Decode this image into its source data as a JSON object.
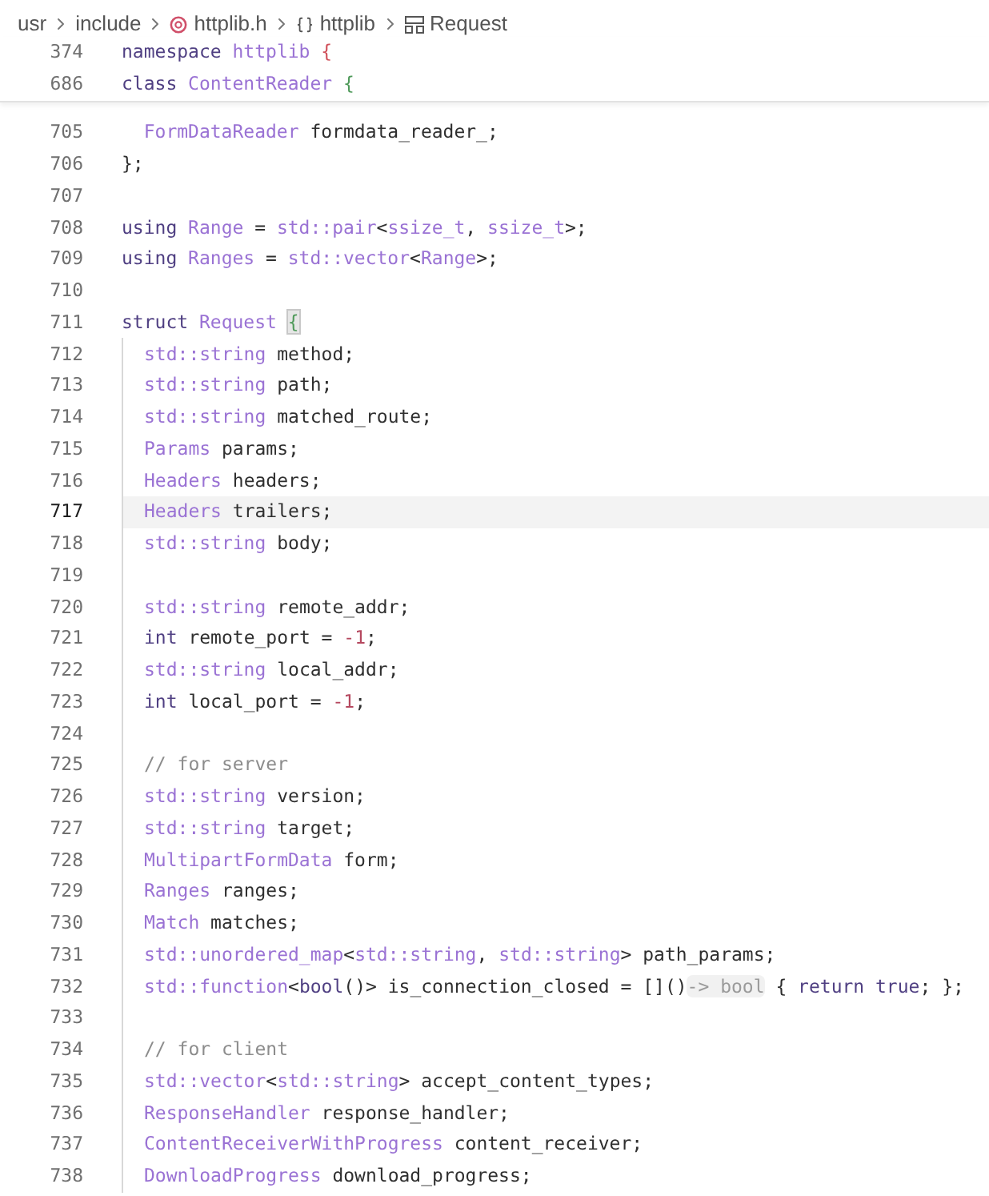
{
  "breadcrumb": [
    {
      "label": "usr",
      "kind": "folder"
    },
    {
      "label": "include",
      "kind": "folder"
    },
    {
      "label": "httplib.h",
      "kind": "file"
    },
    {
      "label": "httplib",
      "kind": "namespace"
    },
    {
      "label": "Request",
      "kind": "struct"
    }
  ],
  "sticky_scroll": [
    {
      "number": "374",
      "tokens": [
        {
          "kind": "kw",
          "text": "namespace "
        },
        {
          "kind": "type",
          "text": "httplib "
        },
        {
          "kind": "brace_red",
          "text": "{"
        }
      ]
    },
    {
      "number": "686",
      "tokens": [
        {
          "kind": "kw",
          "text": "class "
        },
        {
          "kind": "type",
          "text": "ContentReader "
        },
        {
          "kind": "brace_green",
          "text": "{"
        }
      ]
    }
  ],
  "lines": [
    {
      "number": "705",
      "current": false,
      "tokens": [
        {
          "kind": "type",
          "text": "  FormDataReader"
        },
        {
          "kind": "plain",
          "text": " formdata_reader_;"
        }
      ]
    },
    {
      "number": "706",
      "current": false,
      "tokens": [
        {
          "kind": "plain",
          "text": "};"
        }
      ]
    },
    {
      "number": "707",
      "current": false
    },
    {
      "number": "708",
      "current": false,
      "tokens": [
        {
          "kind": "kw",
          "text": "using "
        },
        {
          "kind": "type",
          "text": "Range"
        },
        {
          "kind": "plain",
          "text": " = "
        },
        {
          "kind": "type",
          "text": "std::pair"
        },
        {
          "kind": "plain",
          "text": "<"
        },
        {
          "kind": "type",
          "text": "ssize_t"
        },
        {
          "kind": "plain",
          "text": ", "
        },
        {
          "kind": "type",
          "text": "ssize_t"
        },
        {
          "kind": "plain",
          "text": ">;"
        }
      ]
    },
    {
      "number": "709",
      "current": false,
      "tokens": [
        {
          "kind": "kw",
          "text": "using "
        },
        {
          "kind": "type",
          "text": "Ranges"
        },
        {
          "kind": "plain",
          "text": " = "
        },
        {
          "kind": "type",
          "text": "std::vector"
        },
        {
          "kind": "plain",
          "text": "<"
        },
        {
          "kind": "type",
          "text": "Range"
        },
        {
          "kind": "plain",
          "text": ">;"
        }
      ]
    },
    {
      "number": "710",
      "current": false
    },
    {
      "number": "711",
      "current": false,
      "tokens": [
        {
          "kind": "kw",
          "text": "struct "
        },
        {
          "kind": "type",
          "text": "Request "
        },
        {
          "kind": "brace_match",
          "text": "{"
        }
      ],
      "children": [
        {
          "number": "712",
          "current": false,
          "tokens": [
            {
              "kind": "type",
              "text": "std::string"
            },
            {
              "kind": "plain",
              "text": " method;"
            }
          ]
        },
        {
          "number": "713",
          "current": false,
          "tokens": [
            {
              "kind": "type",
              "text": "std::string"
            },
            {
              "kind": "plain",
              "text": " path;"
            }
          ]
        },
        {
          "number": "714",
          "current": false,
          "tokens": [
            {
              "kind": "type",
              "text": "std::string"
            },
            {
              "kind": "plain",
              "text": " matched_route;"
            }
          ]
        },
        {
          "number": "715",
          "current": false,
          "tokens": [
            {
              "kind": "type",
              "text": "Params"
            },
            {
              "kind": "plain",
              "text": " params;"
            }
          ]
        },
        {
          "number": "716",
          "current": false,
          "tokens": [
            {
              "kind": "type",
              "text": "Headers"
            },
            {
              "kind": "plain",
              "text": " headers;"
            }
          ]
        },
        {
          "number": "717",
          "current": true,
          "tokens": [
            {
              "kind": "type",
              "text": "Headers"
            },
            {
              "kind": "plain",
              "text": " trailers;"
            }
          ]
        },
        {
          "number": "718",
          "current": false,
          "tokens": [
            {
              "kind": "type",
              "text": "std::string"
            },
            {
              "kind": "plain",
              "text": " body;"
            }
          ]
        },
        {
          "number": "719",
          "current": false
        },
        {
          "number": "720",
          "current": false,
          "tokens": [
            {
              "kind": "type",
              "text": "std::string"
            },
            {
              "kind": "plain",
              "text": " remote_addr;"
            }
          ]
        },
        {
          "number": "721",
          "current": false,
          "tokens": [
            {
              "kind": "kw",
              "text": "int"
            },
            {
              "kind": "plain",
              "text": " remote_port = "
            },
            {
              "kind": "num",
              "text": "-1"
            },
            {
              "kind": "plain",
              "text": ";"
            }
          ]
        },
        {
          "number": "722",
          "current": false,
          "tokens": [
            {
              "kind": "type",
              "text": "std::string"
            },
            {
              "kind": "plain",
              "text": " local_addr;"
            }
          ]
        },
        {
          "number": "723",
          "current": false,
          "tokens": [
            {
              "kind": "kw",
              "text": "int"
            },
            {
              "kind": "plain",
              "text": " local_port = "
            },
            {
              "kind": "num",
              "text": "-1"
            },
            {
              "kind": "plain",
              "text": ";"
            }
          ]
        },
        {
          "number": "724",
          "current": false
        },
        {
          "number": "725",
          "current": false,
          "tokens": [
            {
              "kind": "comment",
              "text": "// for server"
            }
          ]
        },
        {
          "number": "726",
          "current": false,
          "tokens": [
            {
              "kind": "type",
              "text": "std::string"
            },
            {
              "kind": "plain",
              "text": " version;"
            }
          ]
        },
        {
          "number": "727",
          "current": false,
          "tokens": [
            {
              "kind": "type",
              "text": "std::string"
            },
            {
              "kind": "plain",
              "text": " target;"
            }
          ]
        },
        {
          "number": "728",
          "current": false,
          "tokens": [
            {
              "kind": "type",
              "text": "MultipartFormData"
            },
            {
              "kind": "plain",
              "text": " form;"
            }
          ]
        },
        {
          "number": "729",
          "current": false,
          "tokens": [
            {
              "kind": "type",
              "text": "Ranges"
            },
            {
              "kind": "plain",
              "text": " ranges;"
            }
          ]
        },
        {
          "number": "730",
          "current": false,
          "tokens": [
            {
              "kind": "type",
              "text": "Match"
            },
            {
              "kind": "plain",
              "text": " matches;"
            }
          ]
        },
        {
          "number": "731",
          "current": false,
          "tokens": [
            {
              "kind": "type",
              "text": "std::unordered_map"
            },
            {
              "kind": "plain",
              "text": "<"
            },
            {
              "kind": "type",
              "text": "std::string"
            },
            {
              "kind": "plain",
              "text": ", "
            },
            {
              "kind": "type",
              "text": "std::string"
            },
            {
              "kind": "plain",
              "text": "> path_params;"
            }
          ]
        },
        {
          "number": "732",
          "current": false,
          "tokens": [
            {
              "kind": "type",
              "text": "std::function"
            },
            {
              "kind": "plain",
              "text": "<"
            },
            {
              "kind": "kw",
              "text": "bool"
            },
            {
              "kind": "plain",
              "text": "()> is_connection_closed = []()"
            },
            {
              "kind": "hint",
              "text": "-> bool"
            },
            {
              "kind": "plain",
              "text": " { "
            },
            {
              "kind": "kw",
              "text": "return true"
            },
            {
              "kind": "plain",
              "text": "; };"
            }
          ]
        },
        {
          "number": "733",
          "current": false
        },
        {
          "number": "734",
          "current": false,
          "tokens": [
            {
              "kind": "comment",
              "text": "// for client"
            }
          ]
        },
        {
          "number": "735",
          "current": false,
          "tokens": [
            {
              "kind": "type",
              "text": "std::vector"
            },
            {
              "kind": "plain",
              "text": "<"
            },
            {
              "kind": "type",
              "text": "std::string"
            },
            {
              "kind": "plain",
              "text": "> accept_content_types;"
            }
          ]
        },
        {
          "number": "736",
          "current": false,
          "tokens": [
            {
              "kind": "type",
              "text": "ResponseHandler"
            },
            {
              "kind": "plain",
              "text": " response_handler;"
            }
          ]
        },
        {
          "number": "737",
          "current": false,
          "tokens": [
            {
              "kind": "type",
              "text": "ContentReceiverWithProgress"
            },
            {
              "kind": "plain",
              "text": " content_receiver;"
            }
          ]
        },
        {
          "number": "738",
          "current": false,
          "tokens": [
            {
              "kind": "type",
              "text": "DownloadProgress"
            },
            {
              "kind": "plain",
              "text": " download_progress;"
            }
          ]
        }
      ]
    }
  ]
}
